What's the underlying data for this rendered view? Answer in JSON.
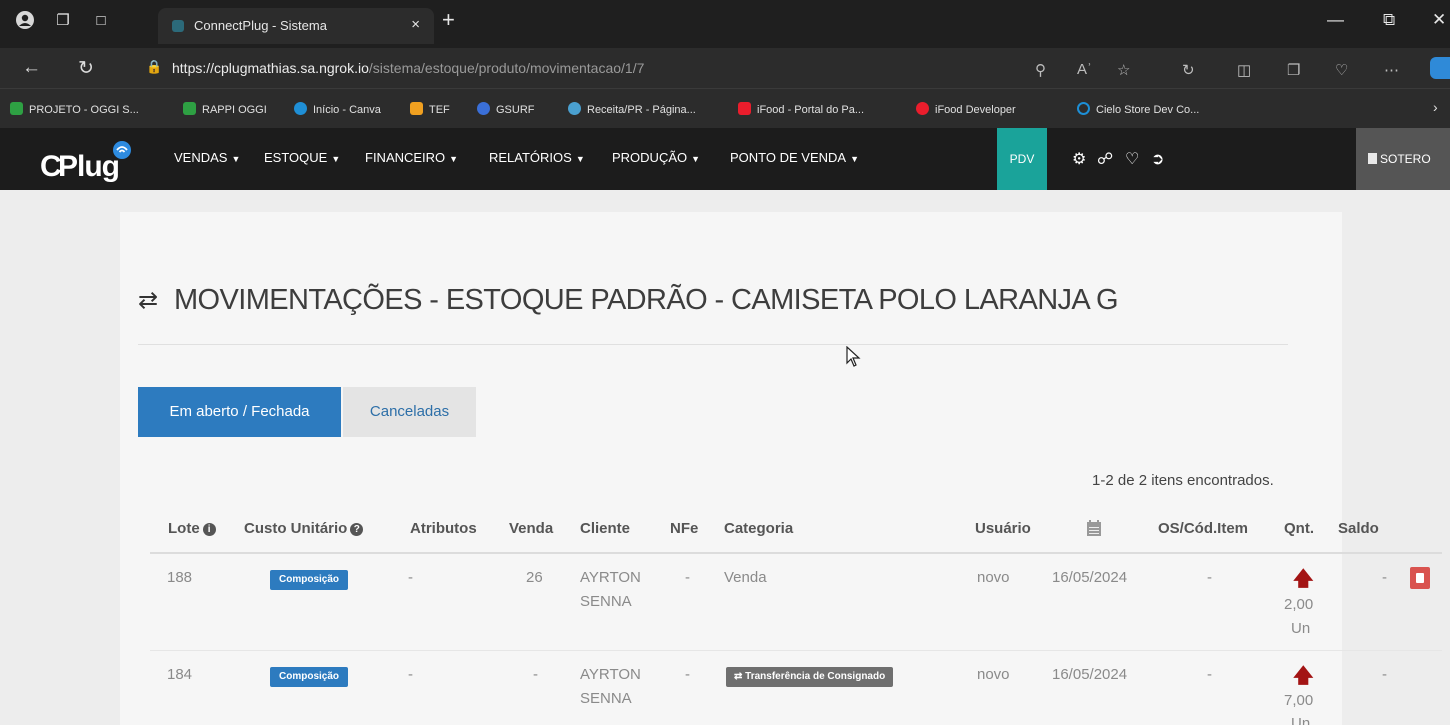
{
  "browser": {
    "tab_title": "ConnectPlug - Sistema",
    "tab_close": "×",
    "new_tab": "+",
    "url_host": "https://cplugmathias.sa.ngrok.io",
    "url_path": "/sistema/estoque/produto/movimentacao/1/7",
    "bookmarks": [
      {
        "label": "PROJETO - OGGI S...",
        "color": "#2ea043"
      },
      {
        "label": "RAPPI OGGI",
        "color": "#2ea043"
      },
      {
        "label": "Início - Canva",
        "color": "#1f8fd6"
      },
      {
        "label": "TEF",
        "color": "#f0a020"
      },
      {
        "label": "GSURF",
        "color": "#3a6fd8"
      },
      {
        "label": "Receita/PR - Página...",
        "color": "#4aa0d0"
      },
      {
        "label": "iFood - Portal do Pa...",
        "color": "#ea1d2c"
      },
      {
        "label": "iFood Developer",
        "color": "#ea1d2c"
      },
      {
        "label": "Cielo Store Dev Co...",
        "color": "#1d8fd6"
      }
    ]
  },
  "app": {
    "logo": "CPlug",
    "menu": [
      {
        "label": "VENDAS"
      },
      {
        "label": "ESTOQUE"
      },
      {
        "label": "FINANCEIRO"
      },
      {
        "label": "RELATÓRIOS"
      },
      {
        "label": "PRODUÇÃO"
      },
      {
        "label": "PONTO DE VENDA"
      }
    ],
    "pdv_label": "PDV",
    "user_label": "SOTERO",
    "accent": "#1aa39a"
  },
  "page": {
    "title": "MOVIMENTAÇÕES - ESTOQUE PADRÃO - CAMISETA POLO LARANJA G",
    "tabs": [
      {
        "label": "Em aberto / Fechada",
        "active": true
      },
      {
        "label": "Canceladas",
        "active": false
      }
    ],
    "results_count": "1-2 de 2 itens encontrados.",
    "columns": {
      "lote": "Lote",
      "custo_unitario": "Custo Unitário",
      "atributos": "Atributos",
      "venda": "Venda",
      "cliente": "Cliente",
      "nfe": "NFe",
      "categoria": "Categoria",
      "usuario": "Usuário",
      "os_cod_item": "OS/Cód.Item",
      "qnt": "Qnt.",
      "saldo": "Saldo"
    },
    "rows": [
      {
        "lote": "188",
        "custo_unitario": "Composição",
        "atributos": "-",
        "venda": "26",
        "cliente_line1": "AYRTON",
        "cliente_line2": "SENNA",
        "nfe": "-",
        "categoria": "Venda",
        "usuario": "novo",
        "data": "16/05/2024",
        "os_cod_item": "-",
        "qnt_value": "2,00",
        "qnt_unit": "Un",
        "saldo": "-"
      },
      {
        "lote": "184",
        "custo_unitario": "Composição",
        "atributos": "-",
        "venda": "-",
        "cliente_line1": "AYRTON",
        "cliente_line2": "SENNA",
        "nfe": "-",
        "categoria": "Transferência de Consignado",
        "usuario": "novo",
        "data": "16/05/2024",
        "os_cod_item": "-",
        "qnt_value": "7,00",
        "qnt_unit": "Un",
        "saldo": "-"
      }
    ]
  }
}
